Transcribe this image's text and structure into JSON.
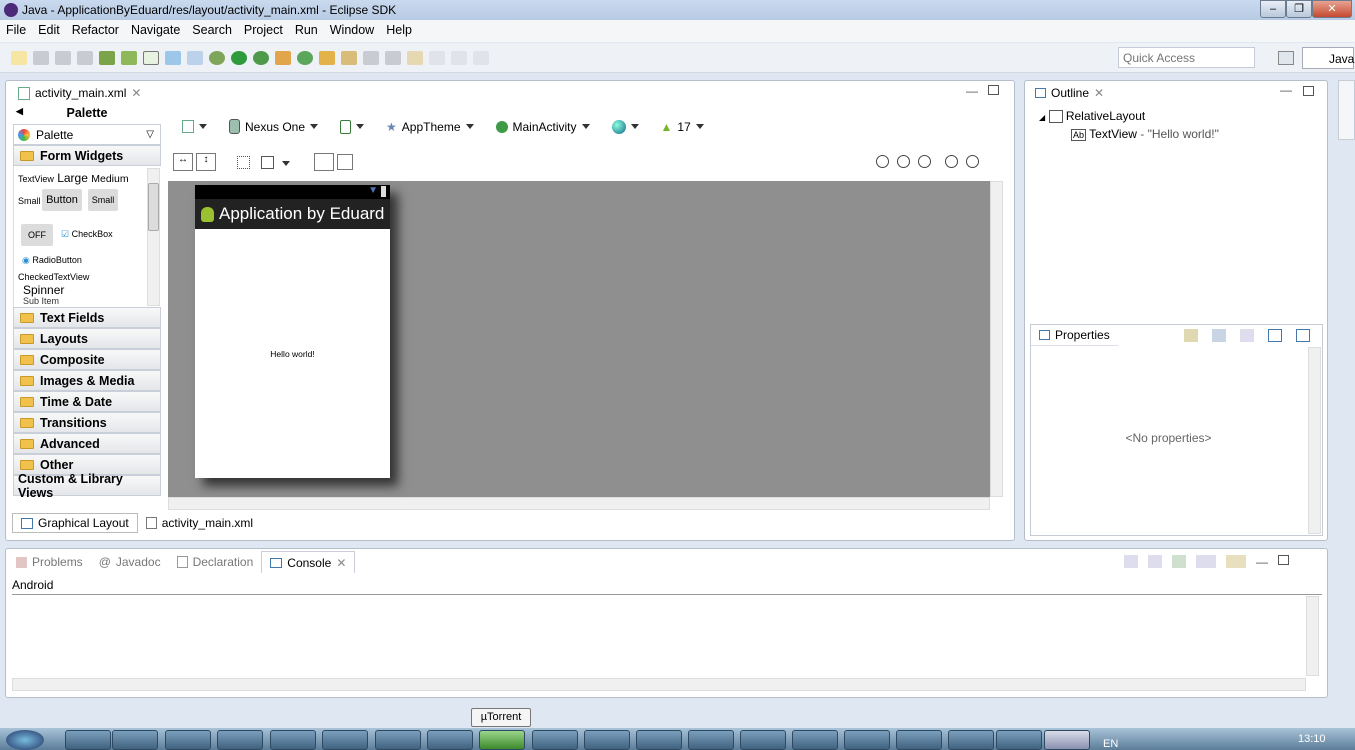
{
  "window": {
    "title": "Java - ApplicationByEduard/res/layout/activity_main.xml - Eclipse SDK"
  },
  "menu": [
    "File",
    "Edit",
    "Refactor",
    "Navigate",
    "Search",
    "Project",
    "Run",
    "Window",
    "Help"
  ],
  "toolbar": {
    "quick_access_placeholder": "Quick Access",
    "perspective": "Java"
  },
  "editor": {
    "tab": "activity_main.xml",
    "palette": {
      "header": "Palette",
      "selector": "Palette",
      "open_category": "Form Widgets",
      "widgets": {
        "textview": "TextView",
        "large": "Large",
        "medium": "Medium",
        "small_label": "Small",
        "button": "Button",
        "small_button": "Small",
        "toggle": "OFF",
        "checkbox": "CheckBox",
        "radio": "RadioButton",
        "checked_text": "CheckedTextView",
        "spinner": "Spinner",
        "sub_item": "Sub Item"
      },
      "categories": [
        "Text Fields",
        "Layouts",
        "Composite",
        "Images & Media",
        "Time & Date",
        "Transitions",
        "Advanced",
        "Other"
      ],
      "custom": "Custom & Library Views"
    },
    "config": {
      "device": "Nexus One",
      "theme": "AppTheme",
      "activity": "MainActivity",
      "api": "17"
    },
    "device_preview": {
      "app_title": "Application by Eduard",
      "content": "Hello world!"
    },
    "bottom_tabs": [
      "Graphical Layout",
      "activity_main.xml"
    ]
  },
  "outline": {
    "title": "Outline",
    "root": "RelativeLayout",
    "child": "TextView",
    "child_value": "- \"Hello world!\""
  },
  "properties": {
    "title": "Properties",
    "empty": "<No properties>"
  },
  "console": {
    "tabs": [
      "Problems",
      "Javadoc",
      "Declaration",
      "Console"
    ],
    "active": "Console",
    "label": "Android"
  },
  "taskbar": {
    "tooltip": "µTorrent",
    "lang": "EN",
    "clock": "13:10"
  }
}
